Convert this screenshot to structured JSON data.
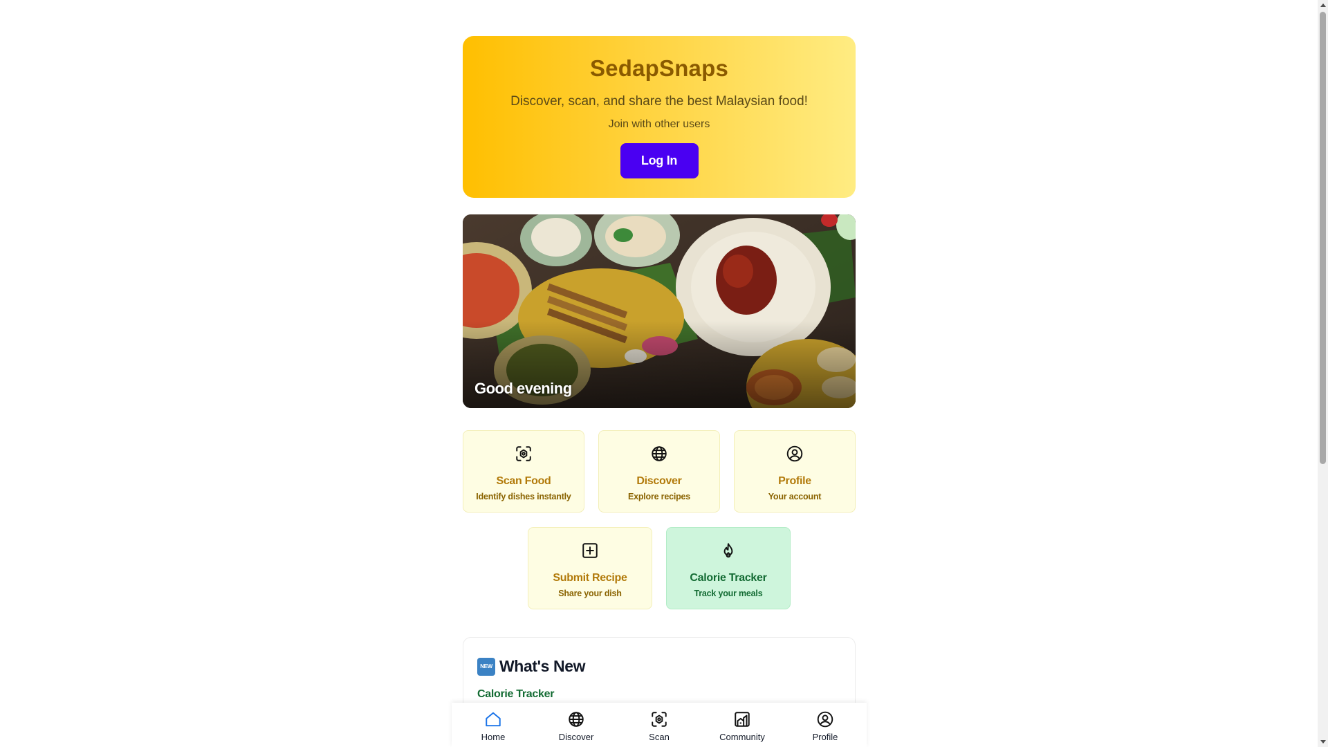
{
  "hero": {
    "title": "SedapSnaps",
    "subtitle": "Discover, scan, and share the best Malaysian food!",
    "tagline": "Join with other users",
    "login_label": "Log In",
    "colors": {
      "gradient_start": "#ffbf00",
      "gradient_end": "#ffec82",
      "button": "#4a00f2"
    }
  },
  "banner": {
    "greeting": "Good evening"
  },
  "quick_actions": [
    {
      "title": "Scan Food",
      "desc": "Identify dishes instantly",
      "icon": "scan-icon"
    },
    {
      "title": "Discover",
      "desc": "Explore recipes",
      "icon": "globe-icon"
    },
    {
      "title": "Profile",
      "desc": "Your account",
      "icon": "user-circle-icon"
    },
    {
      "title": "Submit Recipe",
      "desc": "Share your dish",
      "icon": "plus-square-icon"
    },
    {
      "title": "Calorie Tracker",
      "desc": "Track your meals",
      "icon": "flame-icon"
    }
  ],
  "whats_new": {
    "badge": "NEW",
    "heading": "What's New",
    "items": [
      "Calorie Tracker"
    ]
  },
  "bottom_nav": [
    {
      "label": "Home",
      "icon": "home-icon",
      "active": true
    },
    {
      "label": "Discover",
      "icon": "globe-icon",
      "active": false
    },
    {
      "label": "Scan",
      "icon": "scan-icon",
      "active": false
    },
    {
      "label": "Community",
      "icon": "community-icon",
      "active": false
    },
    {
      "label": "Profile",
      "icon": "user-circle-icon",
      "active": false
    }
  ],
  "colors": {
    "accent_active": "#1a73e8",
    "card_yellow": "#fefde3",
    "card_green": "#cef5dc",
    "text_green": "#136b33",
    "text_gold": "#b27a0a"
  }
}
